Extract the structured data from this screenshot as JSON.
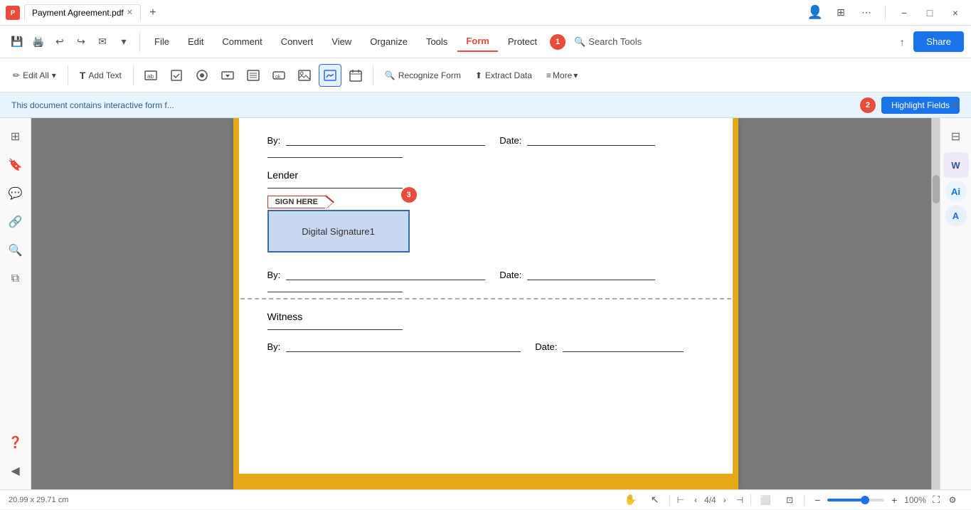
{
  "titlebar": {
    "logo": "P",
    "tab_name": "Payment Agreement.pdf",
    "tab_modified": true,
    "new_tab": "+"
  },
  "window_controls": {
    "close": "×",
    "minimize": "−",
    "maximize": "□"
  },
  "menubar": {
    "items": [
      {
        "id": "file",
        "label": "File"
      },
      {
        "id": "edit",
        "label": "Edit"
      },
      {
        "id": "comment",
        "label": "Comment"
      },
      {
        "id": "convert",
        "label": "Convert"
      },
      {
        "id": "view",
        "label": "View"
      },
      {
        "id": "organize",
        "label": "Organize"
      },
      {
        "id": "tools",
        "label": "Tools"
      },
      {
        "id": "form",
        "label": "Form",
        "active": true
      },
      {
        "id": "protect",
        "label": "Protect"
      }
    ],
    "search_tools": "Search Tools",
    "share": "Share",
    "step1_badge": "1"
  },
  "toolbar": {
    "edit_all": "Edit All",
    "add_text": "Add Text",
    "recognize_form": "Recognize Form",
    "extract_data": "Extract Data",
    "more": "More"
  },
  "notification": {
    "text": "This document contains interactive form f...",
    "highlight_fields": "Highlight Fields",
    "step2_badge": "2"
  },
  "sidebar": {
    "icons": [
      {
        "id": "pages",
        "symbol": "⊞"
      },
      {
        "id": "bookmark",
        "symbol": "🔖"
      },
      {
        "id": "comment",
        "symbol": "💬"
      },
      {
        "id": "link",
        "symbol": "🔗"
      },
      {
        "id": "search",
        "symbol": "🔍"
      },
      {
        "id": "layers",
        "symbol": "⧉"
      }
    ]
  },
  "document": {
    "by_label": "By:",
    "date_label": "Date:",
    "lender_label": "Lender",
    "witness_label": "Witness",
    "sign_here": "SIGN HERE",
    "digital_sig": "Digital Signature1",
    "step3_badge": "3"
  },
  "statusbar": {
    "dimensions": "20.99 x 29.71 cm",
    "page_current": "4",
    "page_total": "4",
    "zoom": "100%"
  }
}
